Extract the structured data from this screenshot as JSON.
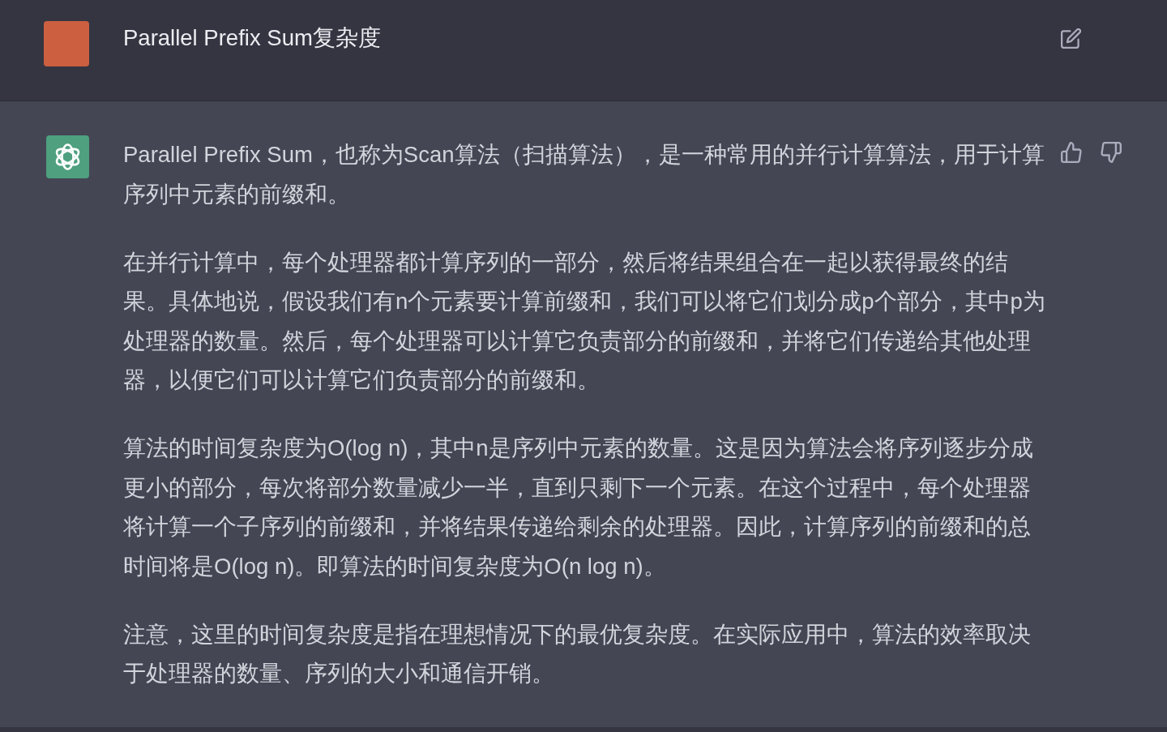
{
  "user_message": {
    "text": "Parallel Prefix Sum复杂度"
  },
  "assistant_message": {
    "paragraphs": [
      "Parallel Prefix Sum，也称为Scan算法（扫描算法），是一种常用的并行计算算法，用于计算序列中元素的前缀和。",
      "在并行计算中，每个处理器都计算序列的一部分，然后将结果组合在一起以获得最终的结果。具体地说，假设我们有n个元素要计算前缀和，我们可以将它们划分成p个部分，其中p为处理器的数量。然后，每个处理器可以计算它负责部分的前缀和，并将它们传递给其他处理器，以便它们可以计算它们负责部分的前缀和。",
      "算法的时间复杂度为O(log n)，其中n是序列中元素的数量。这是因为算法会将序列逐步分成更小的部分，每次将部分数量减少一半，直到只剩下一个元素。在这个过程中，每个处理器将计算一个子序列的前缀和，并将结果传递给剩余的处理器。因此，计算序列的前缀和的总时间将是O(log n)。即算法的时间复杂度为O(n log n)。",
      "注意，这里的时间复杂度是指在理想情况下的最优复杂度。在实际应用中，算法的效率取决于处理器的数量、序列的大小和通信开销。"
    ]
  }
}
